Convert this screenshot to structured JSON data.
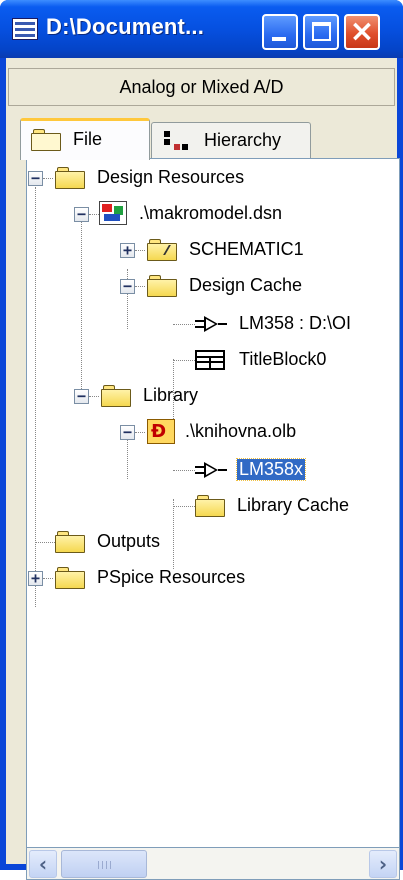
{
  "window": {
    "title": "D:\\Document...",
    "buttons": {
      "minimize": "minimize",
      "maximize": "maximize",
      "close": "×"
    }
  },
  "header": {
    "label": "Analog or Mixed A/D"
  },
  "tabs": [
    {
      "label": "File",
      "active": true,
      "icon": "folder-icon"
    },
    {
      "label": "Hierarchy",
      "active": false,
      "icon": "hierarchy-icon"
    }
  ],
  "tree": {
    "design_resources": "Design Resources",
    "design_file": ".\\makromodel.dsn",
    "schematic": "SCHEMATIC1",
    "design_cache": "Design Cache",
    "cache_part": "LM358 : D:\\OI",
    "title_block": "TitleBlock0",
    "library": "Library",
    "library_file": ".\\knihovna.olb",
    "library_part": "LM358x",
    "library_cache": "Library Cache",
    "outputs": "Outputs",
    "pspice_resources": "PSpice Resources",
    "selected": "LM358x"
  },
  "colors": {
    "titlebar": "#0650e0",
    "selection": "#316ac5",
    "close_button": "#e0502c"
  }
}
